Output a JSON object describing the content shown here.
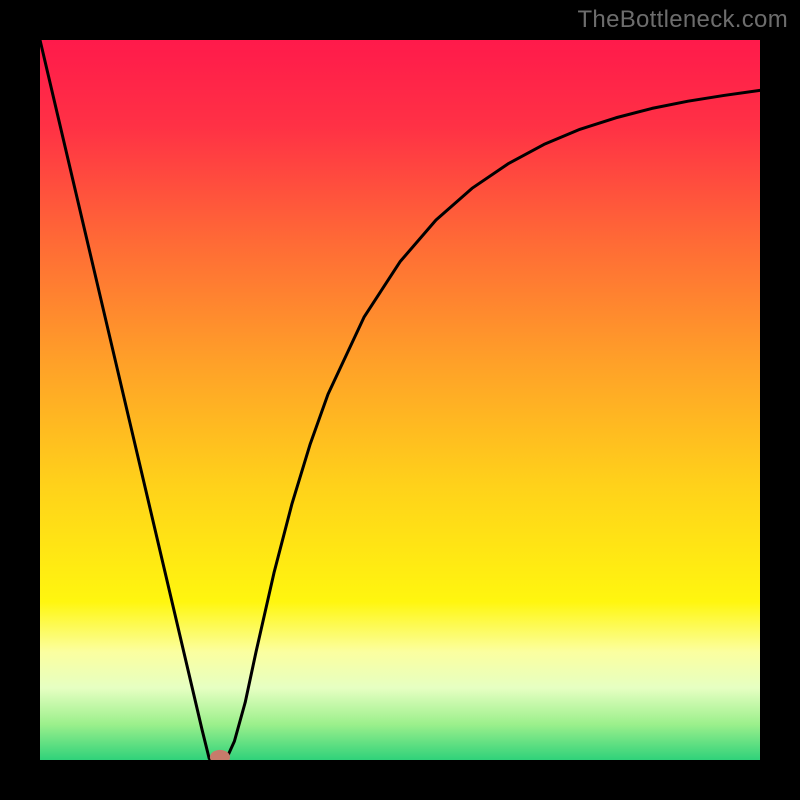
{
  "watermark": "TheBottleneck.com",
  "chart_data": {
    "type": "line",
    "title": "",
    "xlabel": "",
    "ylabel": "",
    "xlim": [
      0,
      100
    ],
    "ylim": [
      0,
      100
    ],
    "grid": false,
    "legend": false,
    "annotations": [],
    "gradient_stops": [
      {
        "offset": 0.0,
        "color": "#ff1a4b"
      },
      {
        "offset": 0.12,
        "color": "#ff3145"
      },
      {
        "offset": 0.28,
        "color": "#ff6a36"
      },
      {
        "offset": 0.45,
        "color": "#ffa128"
      },
      {
        "offset": 0.62,
        "color": "#ffd21a"
      },
      {
        "offset": 0.78,
        "color": "#fff60f"
      },
      {
        "offset": 0.85,
        "color": "#fbffa0"
      },
      {
        "offset": 0.9,
        "color": "#e6ffc2"
      },
      {
        "offset": 0.95,
        "color": "#9cf08c"
      },
      {
        "offset": 1.0,
        "color": "#2fd27a"
      }
    ],
    "series": [
      {
        "name": "curve",
        "color": "#000000",
        "width": 3,
        "x": [
          0.0,
          2.5,
          5.0,
          7.5,
          10.0,
          12.5,
          15.0,
          17.5,
          20.0,
          22.5,
          23.5,
          24.0,
          24.5,
          25.0,
          25.5,
          26.0,
          27.0,
          28.5,
          30.0,
          32.5,
          35.0,
          37.5,
          40.0,
          45.0,
          50.0,
          55.0,
          60.0,
          65.0,
          70.0,
          75.0,
          80.0,
          85.0,
          90.0,
          95.0,
          100.0
        ],
        "y": [
          100.0,
          89.36,
          78.72,
          68.08,
          57.44,
          46.8,
          36.16,
          25.52,
          14.88,
          4.24,
          0.2,
          0.1,
          0.05,
          0.0,
          0.1,
          0.4,
          2.6,
          8.0,
          15.0,
          26.0,
          35.6,
          43.8,
          50.8,
          61.5,
          69.2,
          75.0,
          79.4,
          82.8,
          85.5,
          87.6,
          89.2,
          90.5,
          91.5,
          92.3,
          93.0
        ]
      }
    ],
    "marker": {
      "x": 25.0,
      "y": 0.4,
      "rx": 1.4,
      "ry": 1.0,
      "color": "#c77b6b"
    }
  }
}
